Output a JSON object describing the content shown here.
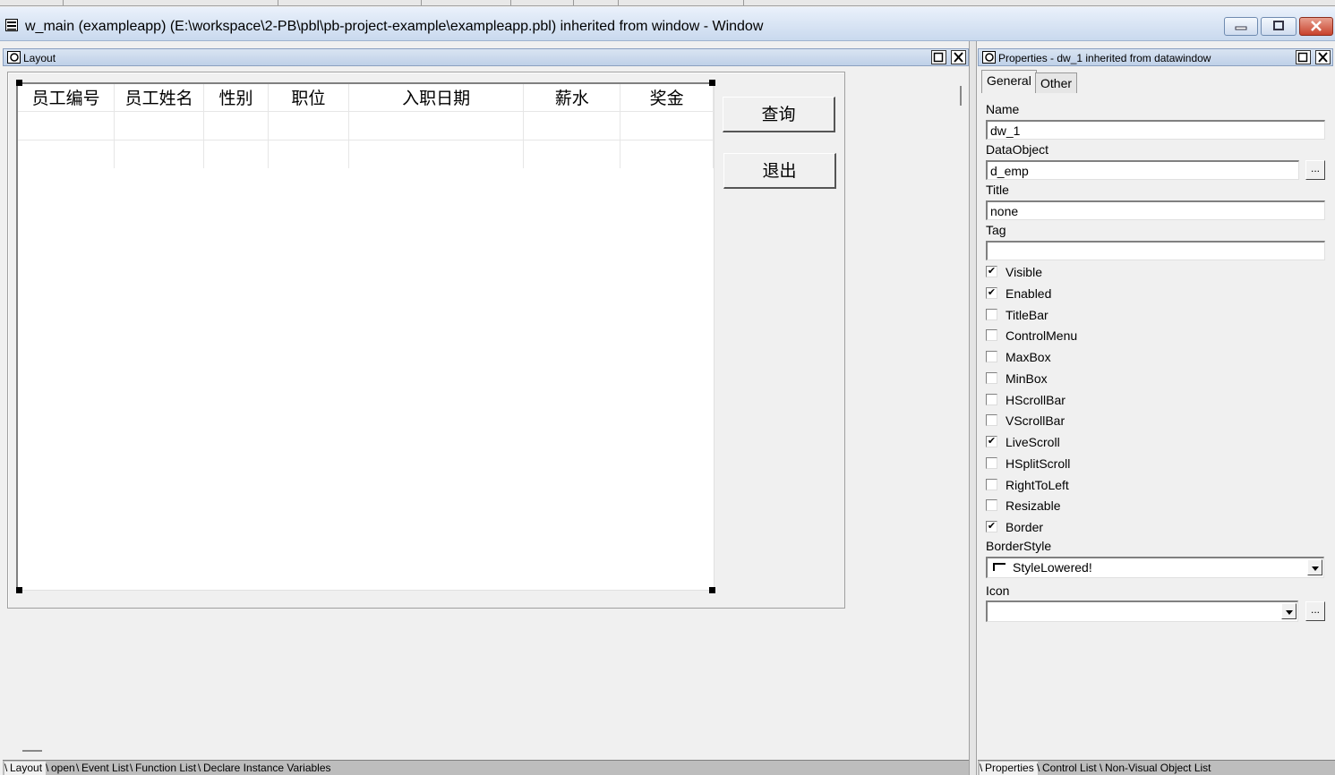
{
  "window": {
    "title": "w_main (exampleapp) (E:\\workspace\\2-PB\\pbl\\pb-project-example\\exampleapp.pbl) inherited from window - Window"
  },
  "layout_pane": {
    "title": "Layout",
    "datawindow": {
      "columns": [
        "员工编号",
        "员工姓名",
        "性别",
        "职位",
        "入职日期",
        "薪水",
        "奖金"
      ]
    },
    "buttons": {
      "query": "查询",
      "exit": "退出"
    }
  },
  "bottom_tabs_left": [
    "Layout",
    "open",
    "Event List",
    "Function List",
    "Declare Instance Variables"
  ],
  "properties_pane": {
    "title": "Properties - dw_1 inherited from datawindow",
    "tabs": [
      "General",
      "Other"
    ],
    "fields": {
      "name_label": "Name",
      "name_value": "dw_1",
      "dataobject_label": "DataObject",
      "dataobject_value": "d_emp",
      "title_label": "Title",
      "title_value": "none",
      "tag_label": "Tag",
      "tag_value": "",
      "borderstyle_label": "BorderStyle",
      "borderstyle_value": "StyleLowered!",
      "icon_label": "Icon",
      "icon_value": "",
      "browse_label": "..."
    },
    "checkboxes": [
      {
        "label": "Visible",
        "checked": true
      },
      {
        "label": "Enabled",
        "checked": true
      },
      {
        "label": "TitleBar",
        "checked": false
      },
      {
        "label": "ControlMenu",
        "checked": false
      },
      {
        "label": "MaxBox",
        "checked": false
      },
      {
        "label": "MinBox",
        "checked": false
      },
      {
        "label": "HScrollBar",
        "checked": false
      },
      {
        "label": "VScrollBar",
        "checked": false
      },
      {
        "label": "LiveScroll",
        "checked": true
      },
      {
        "label": "HSplitScroll",
        "checked": false
      },
      {
        "label": "RightToLeft",
        "checked": false
      },
      {
        "label": "Resizable",
        "checked": false
      },
      {
        "label": "Border",
        "checked": true
      }
    ]
  },
  "bottom_tabs_right": [
    "Properties",
    "Control List",
    "Non-Visual Object List"
  ],
  "check_mark": "✔"
}
